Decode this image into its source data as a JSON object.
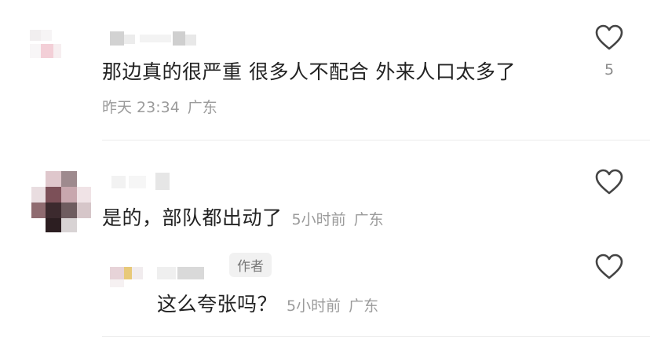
{
  "comments": [
    {
      "text": "那边真的很严重 很多人不配合 外来人口太多了",
      "time": "昨天 23:34",
      "location": "广东",
      "like_count": "5"
    },
    {
      "text": "是的，部队都出动了",
      "time": "5小时前",
      "location": "广东",
      "like_count": ""
    },
    {
      "text": "这么夸张吗？",
      "time": "5小时前",
      "location": "广东",
      "badge": "作者",
      "like_count": ""
    }
  ],
  "colors": {
    "text": "#222222",
    "meta": "#9b9b9b",
    "divider": "#ececec",
    "badge_bg": "#f1f1f1"
  },
  "icons": {
    "like": "heart-outline-icon"
  }
}
